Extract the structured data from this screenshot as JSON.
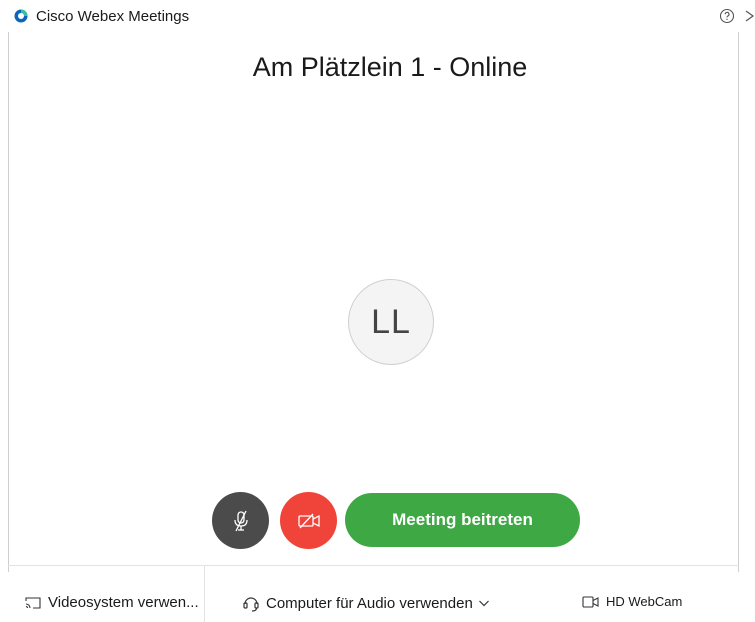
{
  "window": {
    "app_title": "Cisco Webex Meetings",
    "logo_icon": "webex-logo-icon",
    "help_icon": "help-icon",
    "close_icon": "close-icon"
  },
  "meeting": {
    "title": "Am Plätzlein 1 - Online",
    "avatar_initials": "LL"
  },
  "controls": {
    "mute_icon": "microphone-muted-icon",
    "video_icon": "video-off-icon",
    "join_label": "Meeting beitreten"
  },
  "bottom_bar": {
    "videosystem_label": "Videosystem verwen...",
    "audio_label": "Computer für Audio verwenden",
    "webcam_label": "HD WebCam"
  },
  "colors": {
    "mute_button": "#4b4b4b",
    "video_button": "#f0433a",
    "join_button": "#3ea844"
  }
}
